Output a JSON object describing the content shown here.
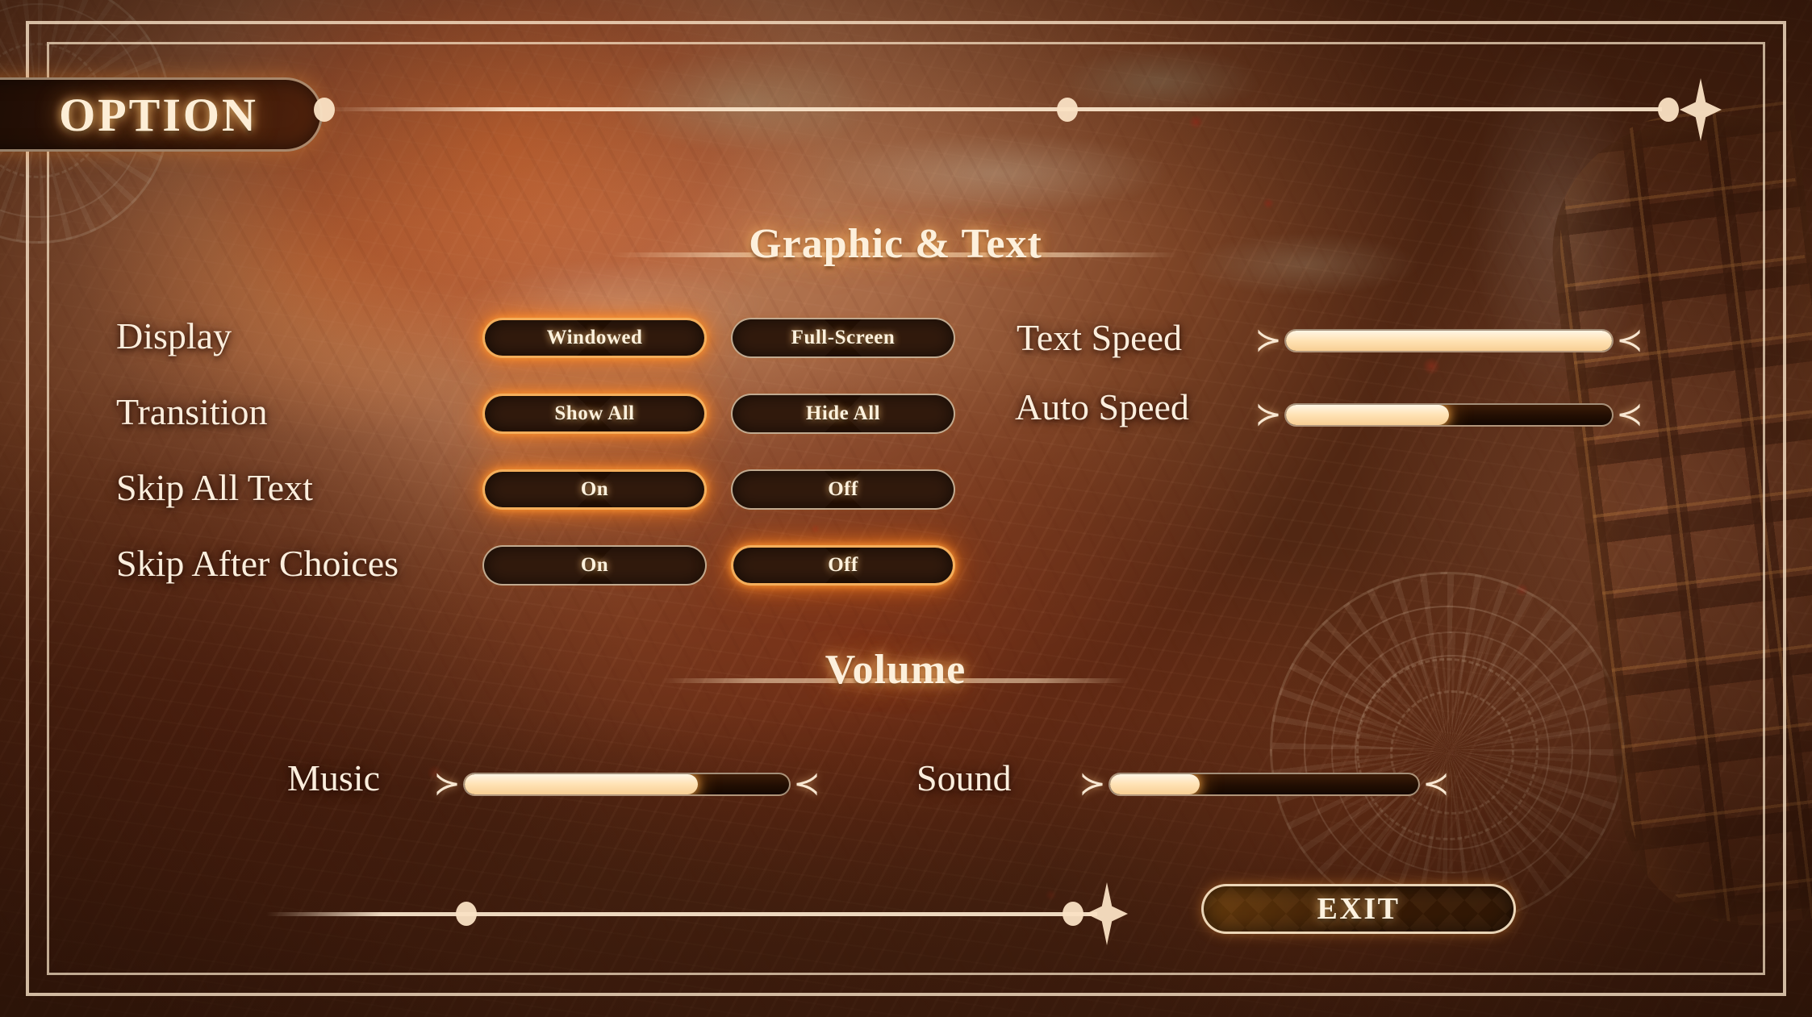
{
  "window": {
    "title": "OPTION",
    "screen_kind": "visual-novel-options-menu"
  },
  "theme": {
    "accent_glow": "#ff8e28",
    "cream": "#fdf0dc",
    "dark_fill": "#2a1305",
    "frame_border": "#fae4c8"
  },
  "decor": {
    "top_sparkle": "four-point-diamond",
    "bottom_sparkle": "four-point-diamond",
    "slider_arrow_left": "≻",
    "slider_arrow_right": "≺"
  },
  "sections": {
    "graphic_text": {
      "heading": "Graphic & Text",
      "rows": [
        {
          "label": "Display",
          "options": [
            {
              "label": "Windowed",
              "selected": true
            },
            {
              "label": "Full-Screen",
              "selected": false
            }
          ]
        },
        {
          "label": "Transition",
          "options": [
            {
              "label": "Show All",
              "selected": true
            },
            {
              "label": "Hide All",
              "selected": false
            }
          ]
        },
        {
          "label": "Skip All Text",
          "options": [
            {
              "label": "On",
              "selected": true
            },
            {
              "label": "Off",
              "selected": false
            }
          ]
        },
        {
          "label": "Skip After Choices",
          "options": [
            {
              "label": "On",
              "selected": false
            },
            {
              "label": "Off",
              "selected": true
            }
          ]
        }
      ],
      "sliders": [
        {
          "label": "Text Speed",
          "value": 100
        },
        {
          "label": "Auto Speed",
          "value": 50
        }
      ]
    },
    "volume": {
      "heading": "Volume",
      "sliders": [
        {
          "label": "Music",
          "value": 72
        },
        {
          "label": "Sound",
          "value": 29
        }
      ]
    }
  },
  "footer": {
    "exit_label": "EXIT"
  }
}
